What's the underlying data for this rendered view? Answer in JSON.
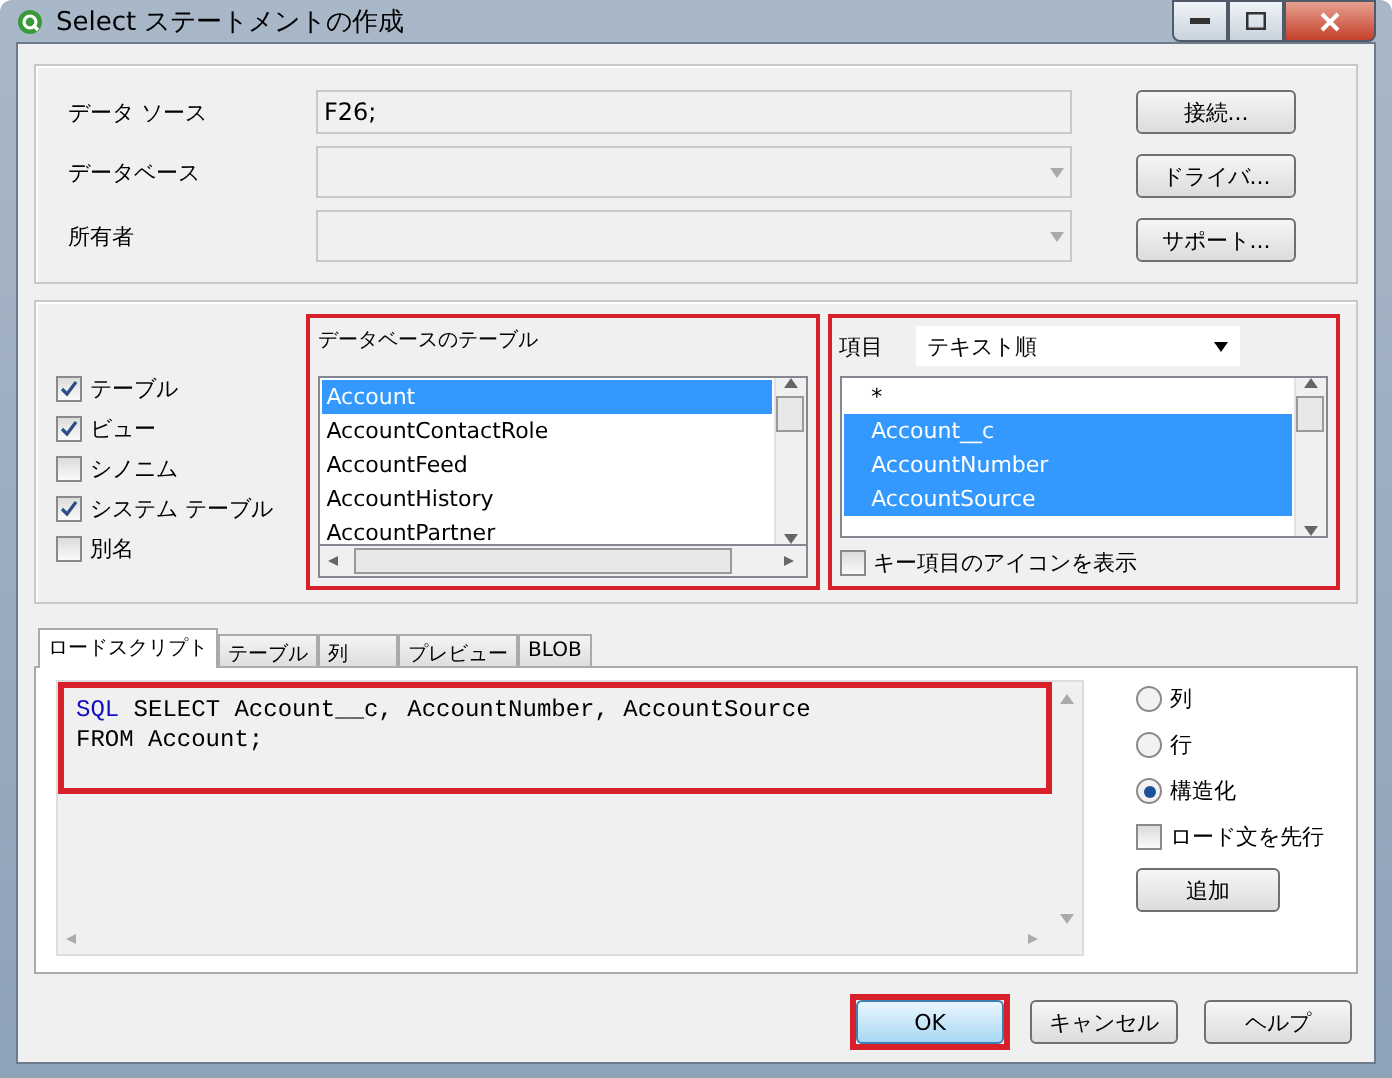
{
  "window": {
    "title": "Select ステートメントの作成"
  },
  "connection": {
    "fields": [
      {
        "label": "データ ソース",
        "value": "F26;",
        "kind": "text"
      },
      {
        "label": "データベース",
        "kind": "dropdown"
      },
      {
        "label": "所有者",
        "kind": "dropdown"
      }
    ],
    "buttons": [
      "接続...",
      "ドライバ...",
      "サポート..."
    ]
  },
  "filters": [
    {
      "label": "テーブル",
      "checked": true
    },
    {
      "label": "ビュー",
      "checked": true
    },
    {
      "label": "シノニム",
      "checked": false
    },
    {
      "label": "システム テーブル",
      "checked": true
    },
    {
      "label": "別名",
      "checked": false
    }
  ],
  "tables": {
    "title": "データベースのテーブル",
    "highlighted": true,
    "items": [
      {
        "label": "Account",
        "selected": true
      },
      {
        "label": "AccountContactRole",
        "selected": false
      },
      {
        "label": "AccountFeed",
        "selected": false
      },
      {
        "label": "AccountHistory",
        "selected": false
      },
      {
        "label": "AccountPartner",
        "selected": false
      }
    ]
  },
  "fields": {
    "label": "項目",
    "sort": "テキスト順",
    "highlighted": true,
    "items": [
      {
        "label": "*",
        "selected": false
      },
      {
        "label": "Account__c",
        "selected": true
      },
      {
        "label": "AccountNumber",
        "selected": true
      },
      {
        "label": "AccountSource",
        "selected": true
      }
    ],
    "key_icons": {
      "label": "キー項目のアイコンを表示",
      "checked": false
    }
  },
  "tabs": [
    {
      "label": "ロードスクリプト",
      "selected": true
    },
    {
      "label": "テーブル",
      "selected": false
    },
    {
      "label": "列",
      "selected": false
    },
    {
      "label": "プレビュー",
      "selected": false
    },
    {
      "label": "BLOB",
      "selected": false
    }
  ],
  "script": {
    "highlighted": true,
    "lines": [
      {
        "keyword": "SQL",
        "text": " SELECT Account__c, AccountNumber, AccountSource"
      },
      {
        "text": "FROM Account;"
      }
    ]
  },
  "layout_options": [
    {
      "label": "列",
      "selected": false
    },
    {
      "label": "行",
      "selected": false
    },
    {
      "label": "構造化",
      "selected": true
    }
  ],
  "preceding_load": {
    "label": "ロード文を先行",
    "checked": false
  },
  "add_button": "追加",
  "footer_buttons": [
    {
      "label": "OK",
      "default": true,
      "highlighted": true
    },
    {
      "label": "キャンセル",
      "default": false,
      "highlighted": false
    },
    {
      "label": "ヘルプ",
      "default": false,
      "highlighted": false
    }
  ]
}
